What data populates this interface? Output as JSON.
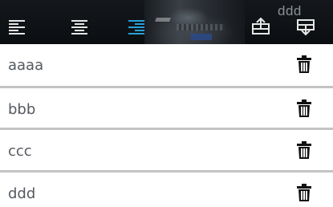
{
  "toolbar": {
    "buttons": [
      {
        "icon": "align-left-icon",
        "state": "inactive"
      },
      {
        "icon": "align-center-icon",
        "state": "inactive"
      },
      {
        "icon": "align-right-icon",
        "state": "active"
      },
      {
        "icon": "upload-tray-icon",
        "state": "inactive"
      },
      {
        "icon": "download-tray-icon",
        "state": "inactive"
      }
    ],
    "overlay_text": "ddd",
    "colors": {
      "icon": "#e6e6e6",
      "active_icon": "#2a9fd6",
      "background": "#0f1215"
    }
  },
  "list": {
    "items": [
      {
        "label": "aaaa"
      },
      {
        "label": "bbb"
      },
      {
        "label": "ccc"
      },
      {
        "label": "ddd"
      }
    ],
    "delete_icon": "trash-icon",
    "colors": {
      "text": "#555a60",
      "divider": "#c4c4c4",
      "icon": "#111111"
    }
  }
}
